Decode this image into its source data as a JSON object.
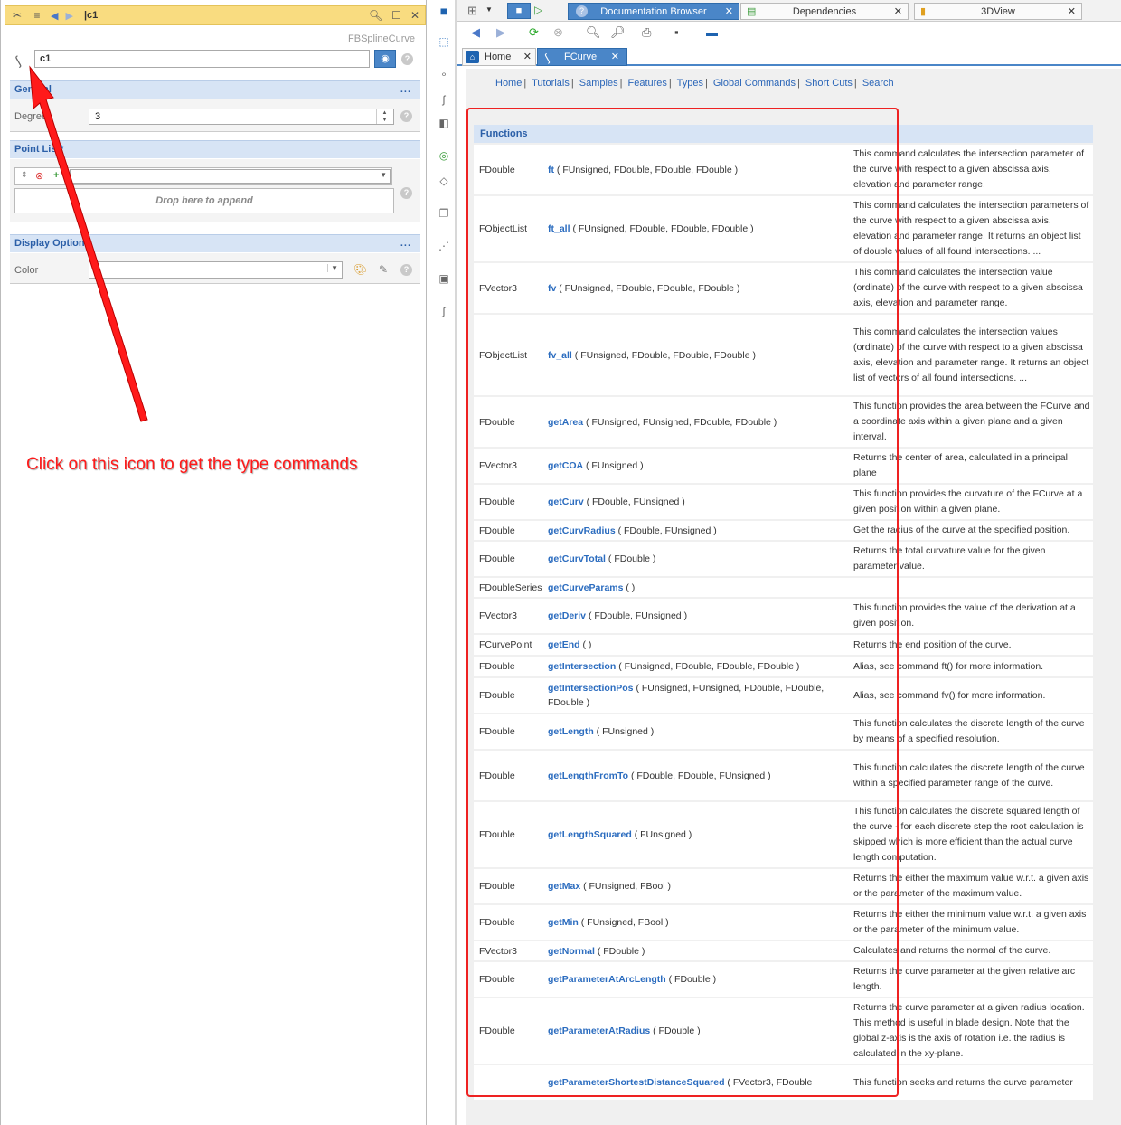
{
  "left_panel": {
    "title": "|c1",
    "type_label": "FBSplineCurve",
    "name_value": "c1",
    "sections": {
      "general": {
        "title": "General",
        "degree_label": "Degree",
        "degree_value": "3"
      },
      "point_list": {
        "title": "Point List*",
        "drop_text": "Drop here to append"
      },
      "display_options": {
        "title": "Display Options",
        "color_label": "Color",
        "color_value": ""
      }
    },
    "section_more": "...",
    "annotation": "Click on this icon to get the type commands"
  },
  "right_panel": {
    "tabs": [
      {
        "label": "Documentation Browser",
        "active": true
      },
      {
        "label": "Dependencies",
        "active": false
      },
      {
        "label": "3DView",
        "active": false
      }
    ],
    "doc_tabs": {
      "home": "Home",
      "current": "FCurve"
    },
    "links": [
      "Home",
      "Tutorials",
      "Samples",
      "Features",
      "Types",
      "Global Commands",
      "Short Cuts",
      "Search"
    ],
    "section_title": "Functions",
    "functions": [
      {
        "ret": "FDouble",
        "name": "ft",
        "params": "( FUnsigned, FDouble, FDouble, FDouble )",
        "desc": "This command calculates the intersection parameter of the curve with respect to a given abscissa axis, elevation and parameter range."
      },
      {
        "ret": "FObjectList",
        "name": "ft_all",
        "params": "( FUnsigned, FDouble, FDouble, FDouble )",
        "desc": "This command calculates the intersection parameters of the curve with respect to a given abscissa axis, elevation and parameter range. It returns an object list of double values of all found intersections. ..."
      },
      {
        "ret": "FVector3",
        "name": "fv",
        "params": "( FUnsigned, FDouble, FDouble, FDouble )",
        "desc": "This command calculates the intersection value (ordinate) of the curve with respect to a given abscissa axis, elevation and parameter range."
      },
      {
        "ret": "FObjectList",
        "name": "fv_all",
        "params": "( FUnsigned, FDouble, FDouble, FDouble )",
        "desc": "This command calculates the intersection values (ordinate) of the curve with respect to a given abscissa axis, elevation and parameter range. It returns an object list of vectors of all found intersections. ..."
      },
      {
        "ret": "FDouble",
        "name": "getArea",
        "params": "( FUnsigned, FUnsigned, FDouble, FDouble )",
        "desc": "This function provides the area between the FCurve and a coordinate axis within a given plane and a given interval."
      },
      {
        "ret": "FVector3",
        "name": "getCOA",
        "params": "( FUnsigned )",
        "desc": "Returns the center of area, calculated in a principal plane"
      },
      {
        "ret": "FDouble",
        "name": "getCurv",
        "params": "( FDouble, FUnsigned )",
        "desc": "This function provides the curvature of the FCurve at a given position within a given plane."
      },
      {
        "ret": "FDouble",
        "name": "getCurvRadius",
        "params": "( FDouble, FUnsigned )",
        "desc": "Get the radius of the curve at the specified position."
      },
      {
        "ret": "FDouble",
        "name": "getCurvTotal",
        "params": "( FDouble )",
        "desc": "Returns the total curvature value for the given parameter value."
      },
      {
        "ret": "FDoubleSeries",
        "name": "getCurveParams",
        "params": "( )",
        "desc": ""
      },
      {
        "ret": "FVector3",
        "name": "getDeriv",
        "params": "( FDouble, FUnsigned )",
        "desc": "This function provides the value of the derivation at a given position."
      },
      {
        "ret": "FCurvePoint",
        "name": "getEnd",
        "params": "( )",
        "desc": "Returns the end position of the curve."
      },
      {
        "ret": "FDouble",
        "name": "getIntersection",
        "params": "( FUnsigned, FDouble, FDouble, FDouble )",
        "desc": "Alias, see command ft() for more information."
      },
      {
        "ret": "FDouble",
        "name": "getIntersectionPos",
        "params": "( FUnsigned, FUnsigned, FDouble, FDouble, FDouble )",
        "desc": "Alias, see command fv() for more information."
      },
      {
        "ret": "FDouble",
        "name": "getLength",
        "params": "( FUnsigned )",
        "desc": "This function calculates the discrete length of the curve by means of a specified resolution."
      },
      {
        "ret": "FDouble",
        "name": "getLengthFromTo",
        "params": "( FDouble, FDouble, FUnsigned )",
        "desc": "This function calculates the discrete length of the curve within a specified parameter range of the curve."
      },
      {
        "ret": "FDouble",
        "name": "getLengthSquared",
        "params": "( FUnsigned )",
        "desc": "This function calculates the discrete squared length of the curve - for each discrete step the root calculation is skipped which is more efficient than the actual curve length computation."
      },
      {
        "ret": "FDouble",
        "name": "getMax",
        "params": "( FUnsigned, FBool )",
        "desc": "Returns the either the maximum value w.r.t. a given axis or the parameter of the maximum value."
      },
      {
        "ret": "FDouble",
        "name": "getMin",
        "params": "( FUnsigned, FBool )",
        "desc": "Returns the either the minimum value w.r.t. a given axis or the parameter of the minimum value."
      },
      {
        "ret": "FVector3",
        "name": "getNormal",
        "params": "( FDouble )",
        "desc": "Calculates and returns the normal of the curve."
      },
      {
        "ret": "FDouble",
        "name": "getParameterAtArcLength",
        "params": "( FDouble )",
        "desc": "Returns the curve parameter at the given relative arc length."
      },
      {
        "ret": "FDouble",
        "name": "getParameterAtRadius",
        "params": "( FDouble )",
        "desc": "Returns the curve parameter at a given radius location. This method is useful in blade design. Note that the global z-axis is the axis of rotation i.e. the radius is calculated in the xy-plane."
      },
      {
        "ret": "",
        "name": "getParameterShortestDistanceSquared",
        "params": "( FVector3, FDouble",
        "desc": "This function seeks and returns the curve parameter"
      }
    ]
  },
  "colors": {
    "accent": "#4a86c8",
    "link": "#2b66b8",
    "section_bg": "#d7e4f5",
    "titlebar": "#f9dc80",
    "annotation": "#ff1a1a"
  },
  "icons": {
    "left_titlebar": [
      "pin-icon",
      "menu-icon",
      "back-arrow-icon",
      "forward-arrow-icon"
    ],
    "left_titlebar_right": [
      "search-icon",
      "window-icon",
      "close-icon"
    ],
    "middle_toolbar": [
      "select-icon",
      "point-icon",
      "curve-icon",
      "surface-icon",
      "circle-icon",
      "shape-icon",
      "copy-icon",
      "dotted-line-icon",
      "solid-icon",
      "spline-icon"
    ],
    "nav_toolbar": [
      "back-icon",
      "forward-icon",
      "refresh-icon",
      "stop-icon",
      "zoom-out-icon",
      "zoom-in-icon",
      "print-icon",
      "save-icon",
      "home-icon"
    ]
  }
}
